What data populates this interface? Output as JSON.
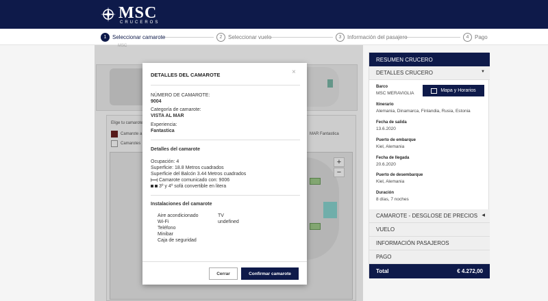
{
  "brand": {
    "name": "MSC",
    "tagline": "CRUCEROS"
  },
  "steps": [
    {
      "num": "1",
      "label": "Seleccionar camarote"
    },
    {
      "num": "2",
      "label": "Seleccionar vuelo"
    },
    {
      "num": "3",
      "label": "Información del pasajero"
    },
    {
      "num": "4",
      "label": "Pago"
    }
  ],
  "background": {
    "ship_label": "MSC",
    "choose_text": "Elige tu camarote",
    "option1": "Camarote a",
    "option2": "Camarotes",
    "fantastica": "MAR Fantastica",
    "zoom_in": "+",
    "zoom_out": "−"
  },
  "modal": {
    "title": "DETALLES DEL CAMAROTE",
    "cabin_number_label": "NÚMERO DE CAMAROTE:",
    "cabin_number": "9004",
    "category_label": "Categoría de camarote:",
    "category": "VISTA AL MAR",
    "experience_label": "Experiencia:",
    "experience": "Fantastica",
    "details_heading": "Detalles del camarote",
    "occupancy": "Ocupación: 4",
    "surface": "Superficie: 18.8 Metros cuadrados",
    "balcony": "Superficie del Balcón 3.44 Metros cuadrados",
    "connected": "Camarote comunicado con: 9006",
    "sofa": "3º y 4º sofá convertible en litera",
    "facilities_heading": "Instalaciones del camarote",
    "facilities_left": [
      "Aire acondicionado",
      "Wi-Fi",
      "Teléfono",
      "Minibar",
      "Caja de seguridad"
    ],
    "facilities_right": [
      "TV",
      "undefined"
    ],
    "cancel": "Cerrar",
    "confirm": "Confirmar camarote",
    "close": "×"
  },
  "summary": {
    "header": "RESUMEN CRUCERO",
    "details_title": "DETALLES CRUCERO",
    "ship_label": "Barco",
    "ship": "MSC MERAVIGLIA",
    "map_button": "Mapa y Horarios",
    "itinerary_label": "Itinerario",
    "itinerary": "Alemania, Dinamarca, Finlandia, Rusia, Estonia",
    "departure_label": "Fecha de salida",
    "departure": "13.6.2020",
    "embark_label": "Puerto de embarque",
    "embark": "Kiel, Alemania",
    "arrival_label": "Fecha de llegada",
    "arrival": "20.6.2020",
    "disembark_label": "Puerto de desembarque",
    "disembark": "Kiel, Alemania",
    "duration_label": "Duración",
    "duration": "8 días, 7 noches",
    "breakdown": "CAMAROTE - DESGLOSE DE PRECIOS",
    "flight": "VUELO",
    "passengers": "INFORMACIÓN PASAJEROS",
    "payment": "PAGO",
    "total_label": "Total",
    "total": "€ 4.272,00"
  },
  "colors": {
    "navy": "#0e1a4a",
    "cabin_green": "#9fcb8a",
    "cabin_teal": "#89d5d0"
  }
}
